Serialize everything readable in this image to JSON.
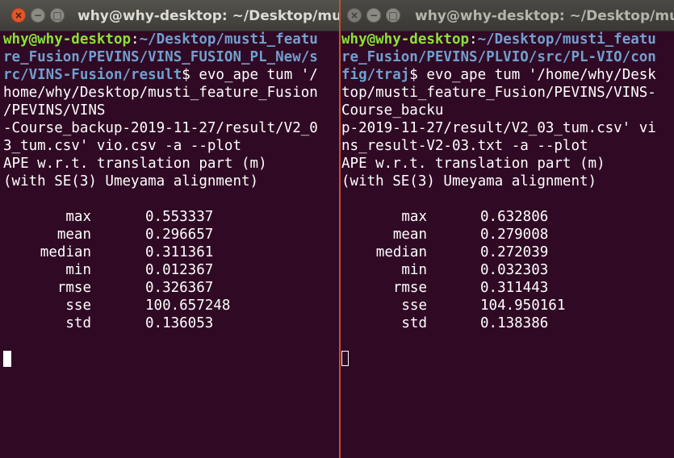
{
  "left": {
    "title": "why@why-desktop: ~/Desktop/mu",
    "prompt_user": "why@why-desktop",
    "prompt_sep": ":",
    "path_lines": [
      "~/Desktop/musti_featu",
      "re_Fusion/PEVINS/VINS_FUSION_PL_New/s",
      "rc/VINS-Fusion/result"
    ],
    "cmd_first": "$ evo_ape tum '/",
    "output_lines": [
      "home/why/Desktop/musti_feature_Fusion",
      "/PEVINS/VINS",
      "-Course_backup-2019-11-27/result/V2_0",
      "3_tum.csv' vio.csv -a --plot",
      "APE w.r.t. translation part (m)",
      "(with SE(3) Umeyama alignment)"
    ],
    "stats": [
      {
        "key": "max",
        "value": "0.553337"
      },
      {
        "key": "mean",
        "value": "0.296657"
      },
      {
        "key": "median",
        "value": "0.311361"
      },
      {
        "key": "min",
        "value": "0.012367"
      },
      {
        "key": "rmse",
        "value": "0.326367"
      },
      {
        "key": "sse",
        "value": "100.657248"
      },
      {
        "key": "std",
        "value": "0.136053"
      }
    ]
  },
  "right": {
    "title": "why@why-desktop: ~/Desktop/mu",
    "prompt_user": "why@why-desktop",
    "prompt_sep": ":",
    "path_lines": [
      "~/Desktop/musti_featu",
      "re_Fusion/PEVINS/PLVIO/src/PL-VIO/con",
      "fig/traj"
    ],
    "cmd_first": "$ evo_ape tum '/home/why/Desk",
    "output_lines": [
      "top/musti_feature_Fusion/PEVINS/VINS-",
      "Course_backu",
      "p-2019-11-27/result/V2_03_tum.csv' vi",
      "ns_result-V2-03.txt -a --plot",
      "APE w.r.t. translation part (m)",
      "(with SE(3) Umeyama alignment)"
    ],
    "stats": [
      {
        "key": "max",
        "value": "0.632806"
      },
      {
        "key": "mean",
        "value": "0.279008"
      },
      {
        "key": "median",
        "value": "0.272039"
      },
      {
        "key": "min",
        "value": "0.032303"
      },
      {
        "key": "rmse",
        "value": "0.311443"
      },
      {
        "key": "sse",
        "value": "104.950161"
      },
      {
        "key": "std",
        "value": "0.138386"
      }
    ]
  },
  "window_buttons": {
    "close": "×",
    "minimize": "−",
    "maximize": "□"
  },
  "colors": {
    "terminal_bg": "#300a24",
    "user": "#8ae234",
    "path": "#729fcf",
    "text": "#ffffff",
    "close_button": "#e0582a"
  }
}
